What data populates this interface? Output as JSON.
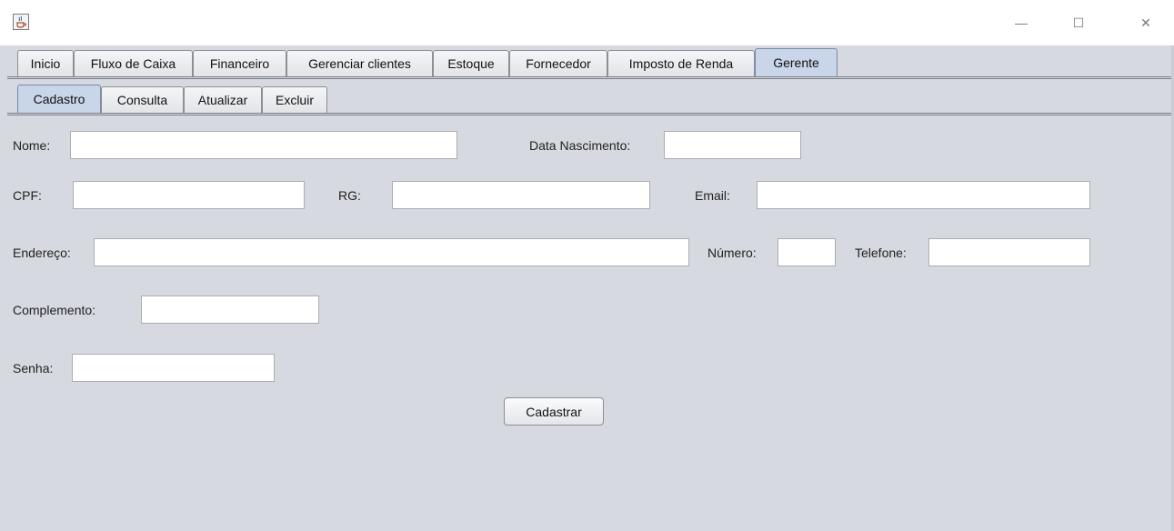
{
  "window": {
    "icon": "java-cup-icon",
    "controls": {
      "minimize": "—",
      "maximize": "☐",
      "close": "✕"
    }
  },
  "main_tabs": [
    {
      "label": "Inicio",
      "selected": false
    },
    {
      "label": "Fluxo de Caixa",
      "selected": false
    },
    {
      "label": "Financeiro",
      "selected": false
    },
    {
      "label": "Gerenciar clientes",
      "selected": false
    },
    {
      "label": "Estoque",
      "selected": false
    },
    {
      "label": "Fornecedor",
      "selected": false
    },
    {
      "label": "Imposto de Renda",
      "selected": false
    },
    {
      "label": "Gerente",
      "selected": true
    }
  ],
  "sub_tabs": [
    {
      "label": "Cadastro",
      "selected": true
    },
    {
      "label": "Consulta",
      "selected": false
    },
    {
      "label": "Atualizar",
      "selected": false
    },
    {
      "label": "Excluir",
      "selected": false
    }
  ],
  "form": {
    "nome": {
      "label": "Nome:",
      "value": ""
    },
    "data_nascimento": {
      "label": "Data Nascimento:",
      "value": ""
    },
    "cpf": {
      "label": "CPF:",
      "value": ""
    },
    "rg": {
      "label": "RG:",
      "value": ""
    },
    "email": {
      "label": "Email:",
      "value": ""
    },
    "endereco": {
      "label": "Endereço:",
      "value": ""
    },
    "numero": {
      "label": "Número:",
      "value": ""
    },
    "telefone": {
      "label": "Telefone:",
      "value": ""
    },
    "complemento": {
      "label": "Complemento:",
      "value": ""
    },
    "senha": {
      "label": "Senha:",
      "value": ""
    },
    "submit_label": "Cadastrar"
  },
  "colors": {
    "panel_background": "#d6d9df",
    "selected_tab": "#c9d5e8",
    "field_background": "#ffffff"
  }
}
